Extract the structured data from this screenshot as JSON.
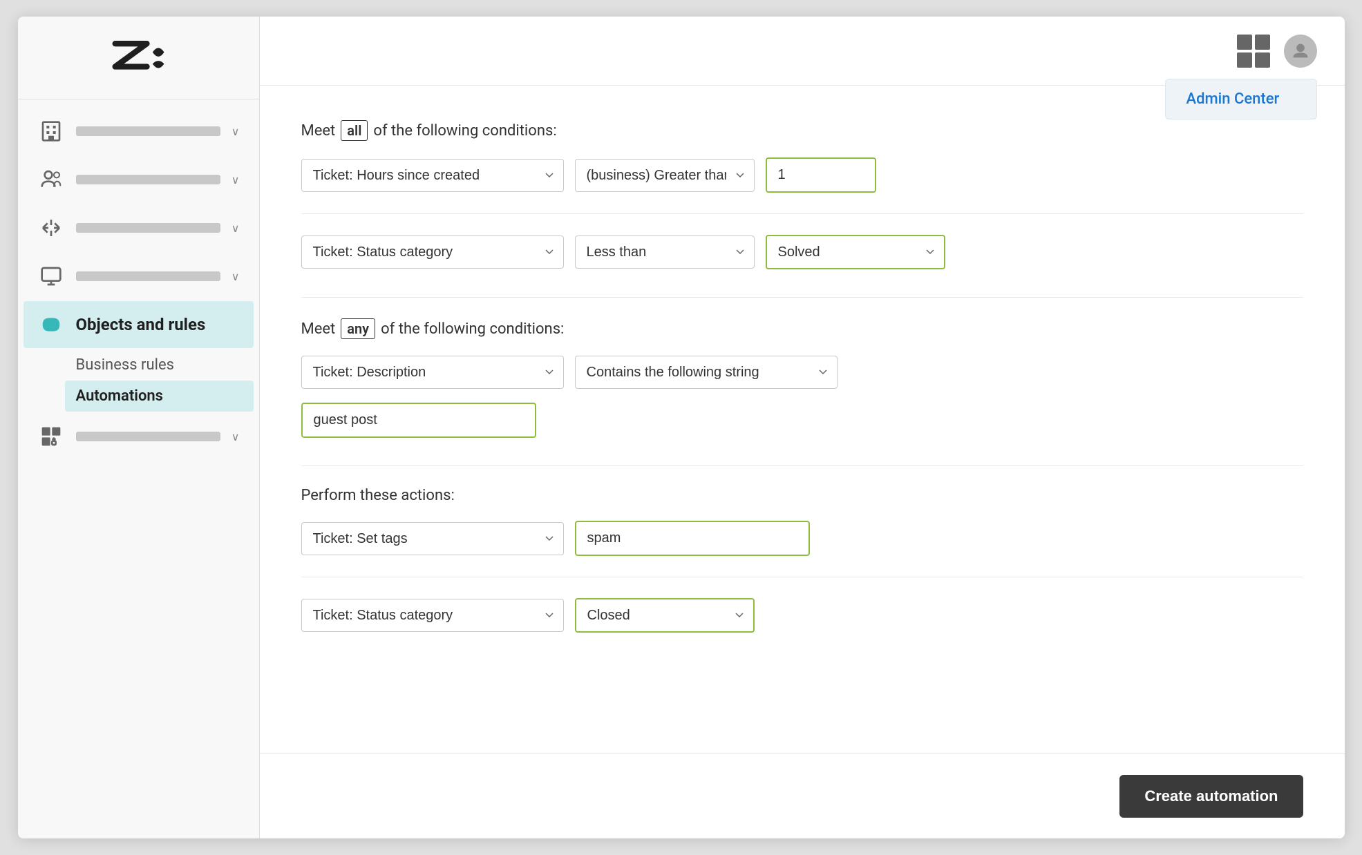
{
  "sidebar": {
    "logo_alt": "Zendesk",
    "nav_items": [
      {
        "id": "workspace",
        "icon": "building-icon",
        "active": false
      },
      {
        "id": "people",
        "icon": "people-icon",
        "active": false
      },
      {
        "id": "channels",
        "icon": "channels-icon",
        "active": false
      },
      {
        "id": "interface",
        "icon": "monitor-icon",
        "active": false
      },
      {
        "id": "objects-rules",
        "icon": "objects-rules-icon",
        "label": "Objects and rules",
        "active": true,
        "subitems": [
          {
            "id": "business-rules",
            "label": "Business rules",
            "active": false
          },
          {
            "id": "automations",
            "label": "Automations",
            "active": true
          }
        ]
      },
      {
        "id": "apps",
        "icon": "apps-icon",
        "active": false
      }
    ]
  },
  "header": {
    "apps_icon_label": "Apps",
    "avatar_label": "User avatar",
    "admin_center_label": "Admin Center"
  },
  "form": {
    "meet_all_label": "Meet",
    "meet_all_badge": "all",
    "meet_all_suffix": "of the following conditions:",
    "condition1": {
      "field_value": "Ticket: Hours since created",
      "operator_value": "(business) Greater than",
      "input_value": "1"
    },
    "condition2": {
      "field_value": "Ticket: Status category",
      "operator_value": "Less than",
      "dropdown_value": "Solved"
    },
    "meet_any_label": "Meet",
    "meet_any_badge": "any",
    "meet_any_suffix": "of the following conditions:",
    "condition3": {
      "field_value": "Ticket: Description",
      "operator_value": "Contains the following string",
      "input_value": "guest post"
    },
    "actions_label": "Perform these actions:",
    "action1": {
      "field_value": "Ticket: Set tags",
      "input_value": "spam"
    },
    "action2": {
      "field_value": "Ticket: Status category",
      "dropdown_value": "Closed"
    },
    "submit_label": "Create automation"
  }
}
